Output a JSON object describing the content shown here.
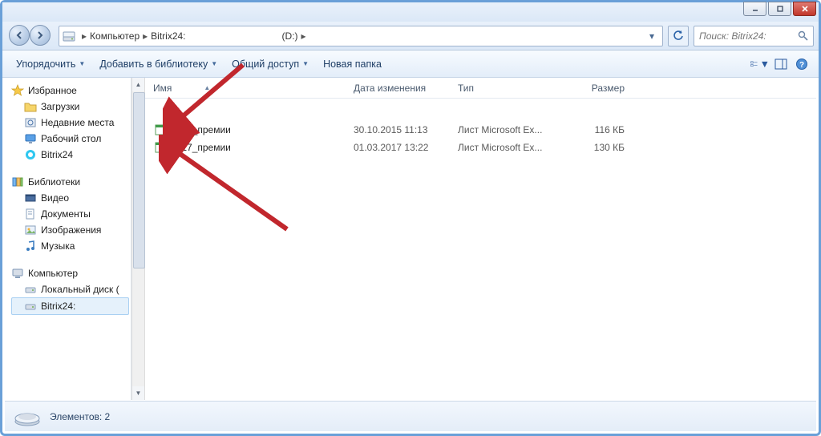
{
  "window": {
    "minimize_tip": "Свернуть",
    "maximize_tip": "Развернуть",
    "close_tip": "Закрыть"
  },
  "breadcrumb": {
    "segments": [
      "Компьютер",
      "Bitrix24:",
      "(D:)"
    ]
  },
  "search": {
    "placeholder": "Поиск: Bitrix24:"
  },
  "toolbar": {
    "organize": "Упорядочить",
    "include": "Добавить в библиотеку",
    "share": "Общий доступ",
    "newfolder": "Новая папка"
  },
  "tree": {
    "favorites": {
      "label": "Избранное",
      "items": [
        "Загрузки",
        "Недавние места",
        "Рабочий стол",
        "Bitrix24"
      ]
    },
    "libraries": {
      "label": "Библиотеки",
      "items": [
        "Видео",
        "Документы",
        "Изображения",
        "Музыка"
      ]
    },
    "computer": {
      "label": "Компьютер",
      "local": "Локальный диск (",
      "bitrix": "Bitrix24:"
    }
  },
  "columns": {
    "name": "Имя",
    "date": "Дата изменения",
    "type": "Тип",
    "size": "Размер"
  },
  "files": [
    {
      "name": "2015_премии",
      "date": "30.10.2015 11:13",
      "type": "Лист Microsoft Ex...",
      "size": "116 КБ"
    },
    {
      "name": "2017_премии",
      "date": "01.03.2017 13:22",
      "type": "Лист Microsoft Ex...",
      "size": "130 КБ"
    }
  ],
  "status": {
    "elements_label": "Элементов:",
    "elements_count": "2"
  }
}
